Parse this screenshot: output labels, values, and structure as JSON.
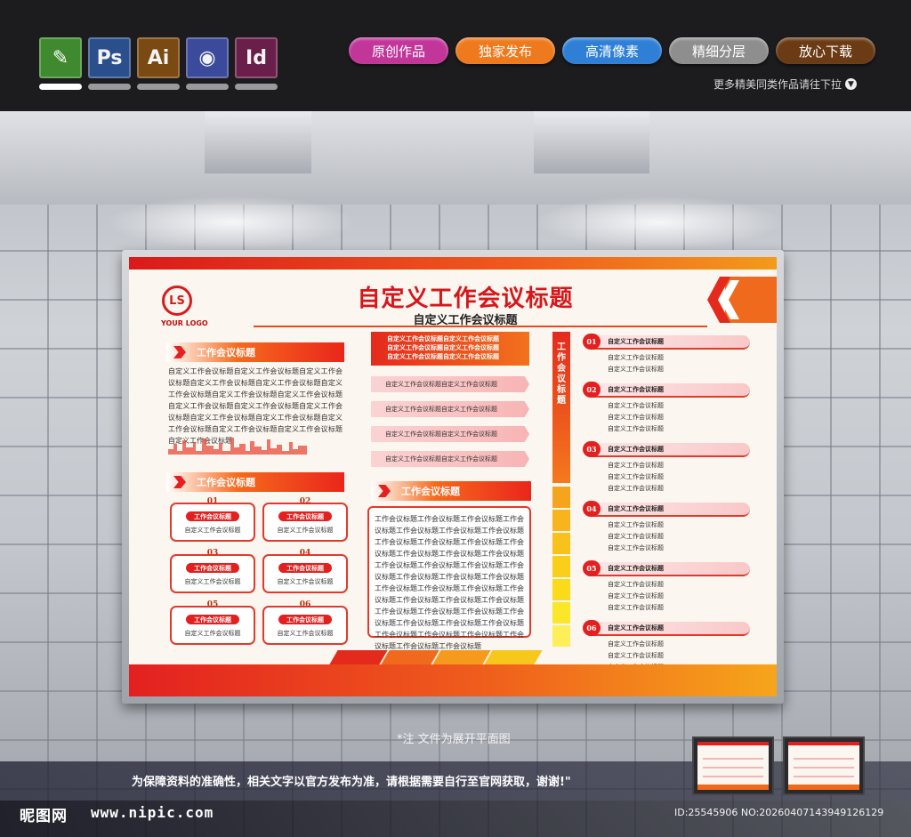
{
  "app_icons": [
    {
      "name": "cdr",
      "label": "",
      "color": "#3f8a2f"
    },
    {
      "name": "ps",
      "label": "Ps",
      "color": "#2b4f8d"
    },
    {
      "name": "ai",
      "label": "Ai",
      "color": "#7a4a12"
    },
    {
      "name": "c4d",
      "label": "",
      "color": "#3b4a9a"
    },
    {
      "name": "id",
      "label": "Id",
      "color": "#6a1f4a"
    }
  ],
  "tags": [
    {
      "label": "原创作品",
      "color": "#c2369a"
    },
    {
      "label": "独家发布",
      "color": "#ef7a1e"
    },
    {
      "label": "高清像素",
      "color": "#2f7fd6"
    },
    {
      "label": "精细分层",
      "color": "#8e8e8e"
    },
    {
      "label": "放心下载",
      "color": "#6a3b14"
    }
  ],
  "more_link": "更多精美同类作品请往下拉",
  "board": {
    "logo_letters": "LS",
    "logo_text": "YOUR LOGO",
    "title": "自定义工作会议标题",
    "subtitle": "自定义工作会议标题",
    "left": {
      "section1_title": "工作会议标题",
      "section1_text": "自定义工作会议标题自定义工作会议标题自定义工作会议标题自定义工作会议标题自定义工作会议标题自定义工作会议标题自定义工作会议标题自定义工作会议标题自定义工作会议标题自定义工作会议标题自定义工作会议标题自定义工作会议标题自定义工作会议标题自定义工作会议标题自定义工作会议标题自定义工作会议标题自定义工作会议标题",
      "section2_title": "工作会议标题",
      "cards": [
        {
          "num": "01",
          "tag": "工作会议标题",
          "text": "自定义工作会议标题"
        },
        {
          "num": "02",
          "tag": "工作会议标题",
          "text": "自定义工作会议标题"
        },
        {
          "num": "03",
          "tag": "工作会议标题",
          "text": "自定义工作会议标题"
        },
        {
          "num": "04",
          "tag": "工作会议标题",
          "text": "自定义工作会议标题"
        },
        {
          "num": "05",
          "tag": "工作会议标题",
          "text": "自定义工作会议标题"
        },
        {
          "num": "06",
          "tag": "工作会议标题",
          "text": "自定义工作会议标题"
        }
      ]
    },
    "middle": {
      "highlight_lines": [
        "自定义工作会议标题自定义工作会议标题",
        "自定义工作会议标题自定义工作会议标题",
        "自定义工作会议标题自定义工作会议标题"
      ],
      "items": [
        "自定义工作会议标题自定义工作会议标题",
        "自定义工作会议标题自定义工作会议标题",
        "自定义工作会议标题自定义工作会议标题",
        "自定义工作会议标题自定义工作会议标题"
      ],
      "section_title": "工作会议标题",
      "section_text": "工作会议标题工作会议标题工作会议标题工作会议标题工作会议标题工作会议标题工作会议标题工作会议标题工作会议标题工作会议标题工作会议标题工作会议标题工作会议标题工作会议标题工作会议标题工作会议标题工作会议标题工作会议标题工作会议标题工作会议标题工作会议标题工作会议标题工作会议标题工作会议标题工作会议标题工作会议标题工作会议标题工作会议标题工作会议标题工作会议标题工作会议标题工作会议标题工作会议标题工作会议标题工作会议标题工作会议标题工作会议标题工作会议标题工作会议标题工作会议标题工作会议标题"
    },
    "vertical_title": "工作会议标题",
    "right_items": [
      {
        "num": "01",
        "title": "自定义工作会议标题",
        "subs": [
          "自定义工作会议标题",
          "自定义工作会议标题"
        ]
      },
      {
        "num": "02",
        "title": "自定义工作会议标题",
        "subs": [
          "自定义工作会议标题",
          "自定义工作会议标题",
          "自定义工作会议标题"
        ]
      },
      {
        "num": "03",
        "title": "自定义工作会议标题",
        "subs": [
          "自定义工作会议标题",
          "自定义工作会议标题",
          "自定义工作会议标题"
        ]
      },
      {
        "num": "04",
        "title": "自定义工作会议标题",
        "subs": [
          "自定义工作会议标题",
          "自定义工作会议标题",
          "自定义工作会议标题"
        ]
      },
      {
        "num": "05",
        "title": "自定义工作会议标题",
        "subs": [
          "自定义工作会议标题",
          "自定义工作会议标题",
          "自定义工作会议标题"
        ]
      },
      {
        "num": "06",
        "title": "自定义工作会议标题",
        "subs": [
          "自定义工作会议标题",
          "自定义工作会议标题",
          "自定义工作会议标题"
        ]
      }
    ]
  },
  "note": "*注  文件为展开平面图",
  "disclaimer": "为保障资料的准确性，相关文字以官方发布为准，请根据需要自行至官网获取，谢谢!\"",
  "site_logo": "昵图网",
  "site_url": "www.nipic.com",
  "image_id": "ID:25545906 NO:20260407143949126129"
}
